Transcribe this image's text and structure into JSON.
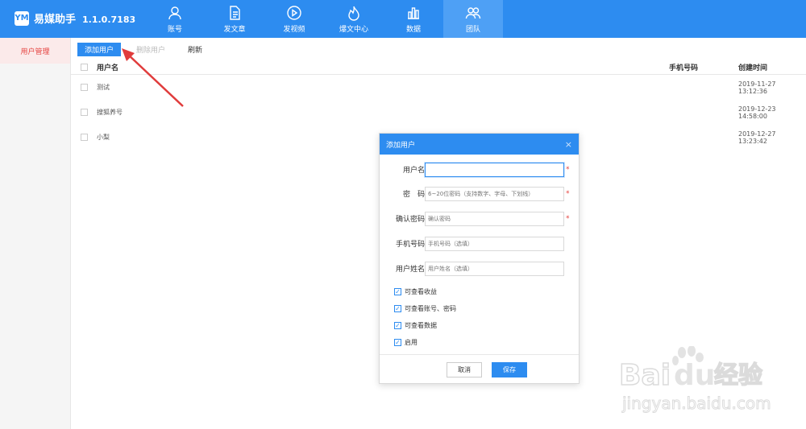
{
  "app": {
    "name": "易媒助手",
    "version": "1.1.0.7183",
    "logo_mark": "YM"
  },
  "nav": [
    {
      "label": "账号",
      "icon": "user-icon"
    },
    {
      "label": "发文章",
      "icon": "document-icon"
    },
    {
      "label": "发视频",
      "icon": "play-icon"
    },
    {
      "label": "爆文中心",
      "icon": "flame-icon"
    },
    {
      "label": "数据",
      "icon": "bar-chart-icon"
    },
    {
      "label": "团队",
      "icon": "team-icon",
      "active": true
    }
  ],
  "sidebar": {
    "items": [
      {
        "label": "用户管理",
        "active": true
      }
    ]
  },
  "toolbar": {
    "add_label": "添加用户",
    "delete_label": "删除用户",
    "refresh_label": "刷新"
  },
  "table": {
    "columns": {
      "username": "用户名",
      "phone": "手机号码",
      "created": "创建时间"
    },
    "rows": [
      {
        "username": "测试",
        "phone": "",
        "created": "2019-11-27 13:12:36"
      },
      {
        "username": "搜狐养号",
        "phone": "",
        "created": "2019-12-23 14:58:00"
      },
      {
        "username": "小梨",
        "phone": "",
        "created": "2019-12-27 13:23:42"
      }
    ]
  },
  "dialog": {
    "title": "添加用户",
    "close": "×",
    "fields": {
      "username": {
        "label": "用户名",
        "value": "",
        "placeholder": "",
        "required_mark": "*"
      },
      "password": {
        "label": "密　码",
        "placeholder": "6~20位密码（支持数字、字母、下划线）",
        "required_mark": "*"
      },
      "confirm": {
        "label": "确认密码",
        "placeholder": "确认密码",
        "required_mark": "*"
      },
      "phone": {
        "label": "手机号码",
        "placeholder": "手机号码（选填）"
      },
      "realname": {
        "label": "用户姓名",
        "placeholder": "用户姓名（选填）"
      }
    },
    "checkboxes": [
      {
        "label": "可查看收益",
        "checked": true
      },
      {
        "label": "可查看账号、密码",
        "checked": true
      },
      {
        "label": "可查看数据",
        "checked": true
      },
      {
        "label": "启用",
        "checked": true
      }
    ],
    "cancel_label": "取消",
    "save_label": "保存"
  },
  "watermark": {
    "brand": "Bai",
    "brand2": "du",
    "cn": "经验",
    "url": "jingyan.baidu.com"
  },
  "colors": {
    "primary": "#2d8cf0",
    "danger": "#e64340",
    "arrow": "#e03c3c"
  }
}
